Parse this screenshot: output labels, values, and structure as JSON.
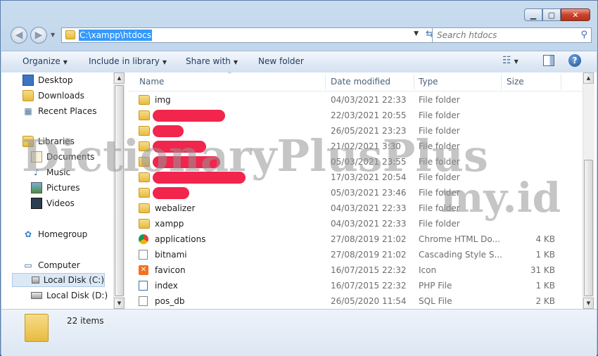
{
  "address": {
    "path": "C:\\xampp\\htdocs"
  },
  "search": {
    "placeholder": "Search htdocs"
  },
  "toolbar": {
    "organize": "Organize",
    "include": "Include in library",
    "share": "Share with",
    "new_folder": "New folder"
  },
  "nav": {
    "items": [
      {
        "label": "Desktop"
      },
      {
        "label": "Downloads"
      },
      {
        "label": "Recent Places"
      },
      {
        "label": "Libraries"
      },
      {
        "label": "Documents"
      },
      {
        "label": "Music"
      },
      {
        "label": "Pictures"
      },
      {
        "label": "Videos"
      },
      {
        "label": "Homegroup"
      },
      {
        "label": "Computer"
      },
      {
        "label": "Local Disk (C:)"
      },
      {
        "label": "Local Disk (D:)"
      }
    ]
  },
  "columns": {
    "name": "Name",
    "date": "Date modified",
    "type": "Type",
    "size": "Size"
  },
  "files": [
    {
      "name": "img",
      "date": "04/03/2021 22:33",
      "type": "File folder",
      "size": "",
      "icon": "folder-icon"
    },
    {
      "name": "",
      "date": "22/03/2021 20:55",
      "type": "File folder",
      "size": "",
      "icon": "folder-icon"
    },
    {
      "name": "",
      "date": "26/05/2021 23:23",
      "type": "File folder",
      "size": "",
      "icon": "folder-icon"
    },
    {
      "name": "",
      "date": "21/02/2021 3:30",
      "type": "File folder",
      "size": "",
      "icon": "folder-icon"
    },
    {
      "name": "",
      "date": "05/03/2021 23:55",
      "type": "File folder",
      "size": "",
      "icon": "folder-icon"
    },
    {
      "name": "",
      "date": "17/03/2021 20:54",
      "type": "File folder",
      "size": "",
      "icon": "folder-icon"
    },
    {
      "name": "",
      "date": "05/03/2021 23:46",
      "type": "File folder",
      "size": "",
      "icon": "folder-icon"
    },
    {
      "name": "webalizer",
      "date": "04/03/2021 22:33",
      "type": "File folder",
      "size": "",
      "icon": "folder-icon"
    },
    {
      "name": "xampp",
      "date": "04/03/2021 22:33",
      "type": "File folder",
      "size": "",
      "icon": "folder-icon"
    },
    {
      "name": "applications",
      "date": "27/08/2019 21:02",
      "type": "Chrome HTML Do...",
      "size": "4 KB",
      "icon": "chrome-icon"
    },
    {
      "name": "bitnami",
      "date": "27/08/2019 21:02",
      "type": "Cascading Style S...",
      "size": "1 KB",
      "icon": "css-file-icon"
    },
    {
      "name": "favicon",
      "date": "16/07/2015 22:32",
      "type": "Icon",
      "size": "31 KB",
      "icon": "xampp-icon"
    },
    {
      "name": "index",
      "date": "16/07/2015 22:32",
      "type": "PHP File",
      "size": "1 KB",
      "icon": "php-file-icon"
    },
    {
      "name": "pos_db",
      "date": "26/05/2020 11:54",
      "type": "SQL File",
      "size": "2 KB",
      "icon": "sql-file-icon"
    }
  ],
  "status": {
    "count": "22 items"
  },
  "watermark": {
    "line1": "DictionaryPlusPlus",
    "line2": "my.id"
  },
  "colors": {
    "selection": "#3399ff",
    "redaction": "#f2254d"
  }
}
